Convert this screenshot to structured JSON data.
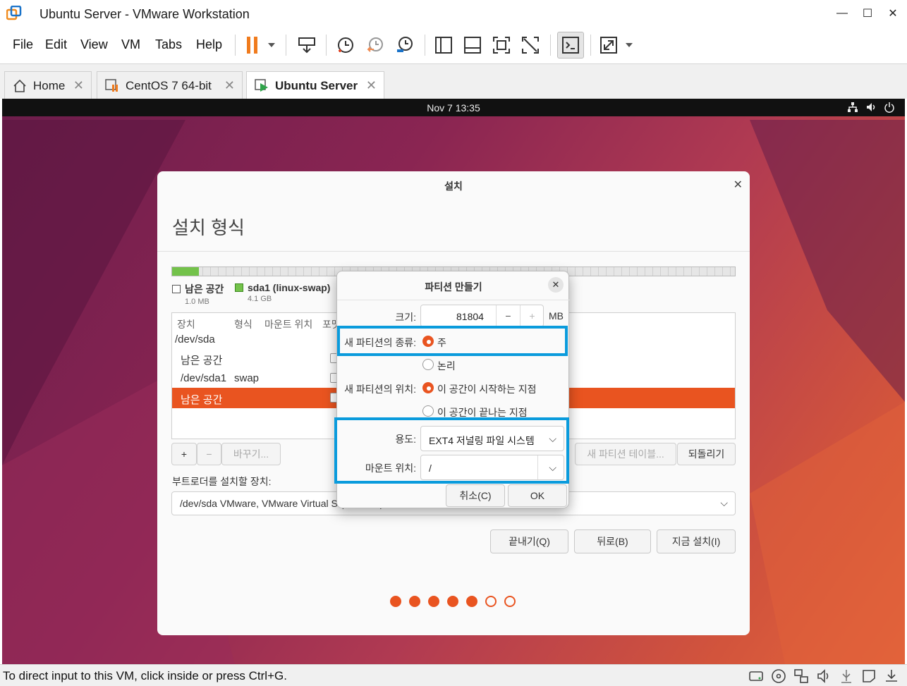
{
  "window": {
    "title": "Ubuntu Server - VMware Workstation",
    "minimize": "—",
    "maximize": "☐",
    "close": "✕"
  },
  "menu": {
    "file": "File",
    "edit": "Edit",
    "view": "View",
    "vm": "VM",
    "tabs": "Tabs",
    "help": "Help"
  },
  "tabs": [
    {
      "label": "Home"
    },
    {
      "label": "CentOS 7 64-bit"
    },
    {
      "label": "Ubuntu Server"
    }
  ],
  "gnome": {
    "clock": "Nov 7  13:35"
  },
  "installer": {
    "window_title": "설치",
    "page_heading": "설치 형식",
    "legend": {
      "free_label": "남은 공간",
      "free_size": "1.0 MB",
      "swap_label": "sda1 (linux-swap)",
      "swap_size": "4.1 GB",
      "free_color": "#ffffff",
      "swap_color": "#73c24a"
    },
    "table": {
      "headers": [
        "장치",
        "형식",
        "마운트 위치",
        "포맷"
      ],
      "rows": [
        {
          "device": "/dev/sda",
          "type": ""
        },
        {
          "device": "남은 공간",
          "type": ""
        },
        {
          "device": "/dev/sda1",
          "type": "swap"
        },
        {
          "device": "남은 공간",
          "type": ""
        }
      ]
    },
    "buttons": {
      "add": "+",
      "remove": "−",
      "change": "바꾸기...",
      "new_table": "새 파티션 테이블...",
      "revert": "되돌리기"
    },
    "bootloader_label": "부트로더를 설치할 장치:",
    "bootloader_value": "/dev/sda VMware, VMware Virtual S (21.5 GB)",
    "nav": {
      "quit": "끝내기(Q)",
      "back": "뒤로(B)",
      "install": "지금 설치(I)"
    },
    "progress": {
      "steps_total": 7,
      "steps_done": 5
    }
  },
  "dialog": {
    "title": "파티션 만들기",
    "size_label": "크기:",
    "size_value": "81804",
    "size_unit": "MB",
    "type_label": "새 파티션의 종류:",
    "type_primary": "주",
    "type_logical": "논리",
    "location_label": "새 파티션의 위치:",
    "location_start": "이 공간이 시작하는 지점",
    "location_end": "이 공간이 끝나는 지점",
    "use_label": "용도:",
    "use_value": "EXT4 저널링 파일 시스템",
    "mount_label": "마운트 위치:",
    "mount_value": "/",
    "cancel": "취소(C)",
    "ok": "OK"
  },
  "status": {
    "message": "To direct input to this VM, click inside or press Ctrl+G."
  },
  "colors": {
    "accent": "#e95420",
    "highlight": "#0a9bdc"
  }
}
